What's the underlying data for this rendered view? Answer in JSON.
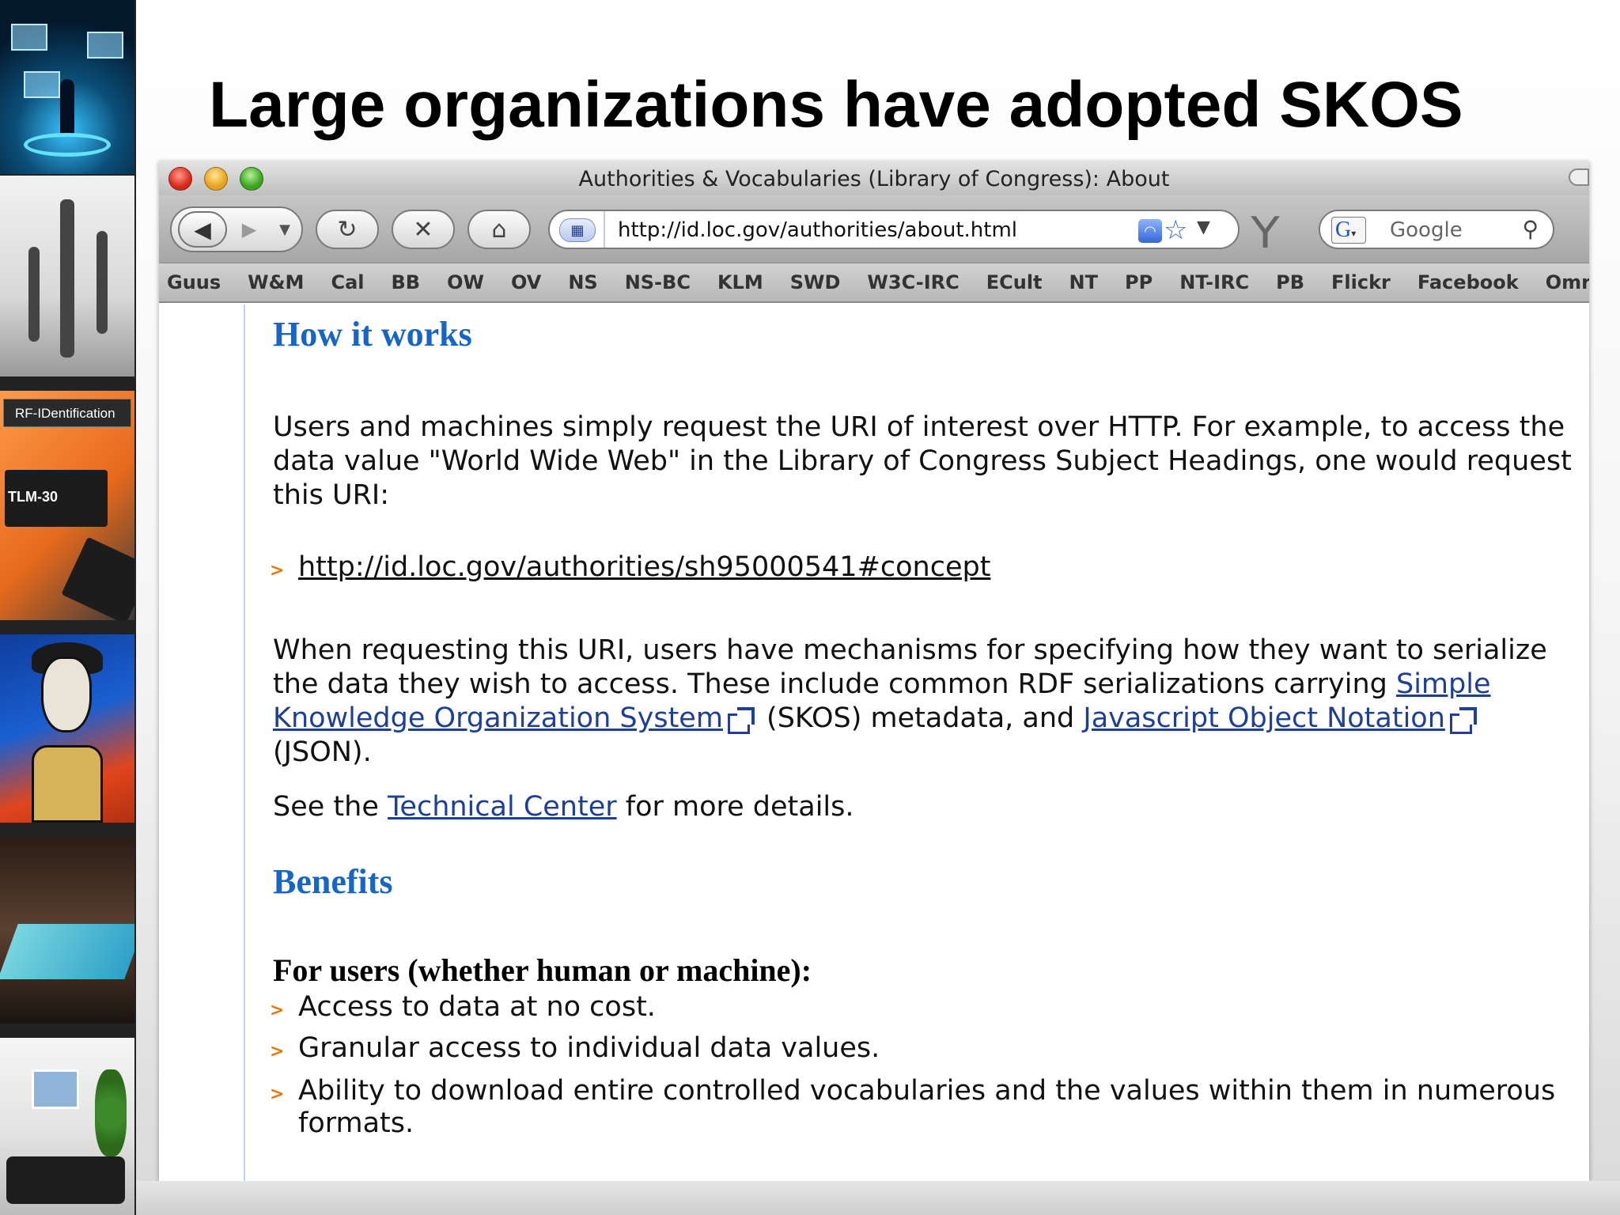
{
  "slide": {
    "title": "Large organizations have adopted SKOS",
    "strip_label_rfid": "RF-IDentification",
    "strip_label_tlm": "TLM-30"
  },
  "browser": {
    "window_title": "Authorities & Vocabularies (Library of Congress): About",
    "url": "http://id.loc.gov/authorities/about.html",
    "search_placeholder": "Google",
    "bookmarks": [
      "Guus",
      "W&M",
      "Cal",
      "BB",
      "OW",
      "OV",
      "NS",
      "NS-BC",
      "KLM",
      "SWD",
      "W3C-IRC",
      "ECult",
      "NT",
      "PP",
      "NT-IRC",
      "PB",
      "Flickr",
      "Facebook",
      "Omroep"
    ]
  },
  "page": {
    "how_it_works_heading": "How it works",
    "para1": "Users and machines simply request the URI of interest over HTTP. For example, to access the data value \"World Wide Web\" in the Library of Congress Subject Headings, one would request this URI:",
    "example_uri": "http://id.loc.gov/authorities/sh95000541#concept",
    "para2_part1": "When requesting this URI, users have mechanisms for specifying how they want to serialize the data they wish to access. These include common RDF serializations carrying ",
    "skos_link": "Simple Knowledge Organization System",
    "para2_part2": " (SKOS) metadata, and ",
    "json_link": "Javascript Object Notation",
    "para2_part3": " (JSON).",
    "para3_part1": "See the ",
    "tech_center_link": "Technical Center",
    "para3_part2": " for more details.",
    "benefits_heading": "Benefits",
    "users_subheading": "For users (whether human or machine):",
    "benefits": [
      "Access to data at no cost.",
      "Granular access to individual data values.",
      "Ability to download entire controlled vocabularies and the values within them in numerous formats."
    ]
  }
}
